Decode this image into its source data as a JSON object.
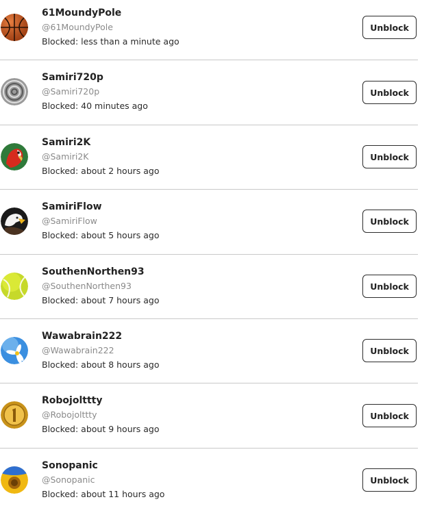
{
  "blocked_users": [
    {
      "name": "61MoundyPole",
      "handle": "@61MoundyPole",
      "blocked": "Blocked: less than a minute ago",
      "button": "Unblock",
      "avatar": "basketball-icon"
    },
    {
      "name": "Samiri720p",
      "handle": "@Samiri720p",
      "blocked": "Blocked: 40 minutes ago",
      "button": "Unblock",
      "avatar": "spiral-rope-icon"
    },
    {
      "name": "Samiri2K",
      "handle": "@Samiri2K",
      "blocked": "Blocked: about 2 hours ago",
      "button": "Unblock",
      "avatar": "parrot-icon"
    },
    {
      "name": "SamiriFlow",
      "handle": "@SamiriFlow",
      "blocked": "Blocked: about 5 hours ago",
      "button": "Unblock",
      "avatar": "eagle-icon"
    },
    {
      "name": "SouthenNorthen93",
      "handle": "@SouthenNorthen93",
      "blocked": "Blocked: about 7 hours ago",
      "button": "Unblock",
      "avatar": "tennis-ball-icon"
    },
    {
      "name": "Wawabrain222",
      "handle": "@Wawabrain222",
      "blocked": "Blocked: about 8 hours ago",
      "button": "Unblock",
      "avatar": "daisy-sky-icon"
    },
    {
      "name": "Robojolttty",
      "handle": "@Robojolttty",
      "blocked": "Blocked: about 9 hours ago",
      "button": "Unblock",
      "avatar": "gold-coin-icon"
    },
    {
      "name": "Sonopanic",
      "handle": "@Sonopanic",
      "blocked": "Blocked: about 11 hours ago",
      "button": "Unblock",
      "avatar": "sunflower-icon"
    }
  ]
}
